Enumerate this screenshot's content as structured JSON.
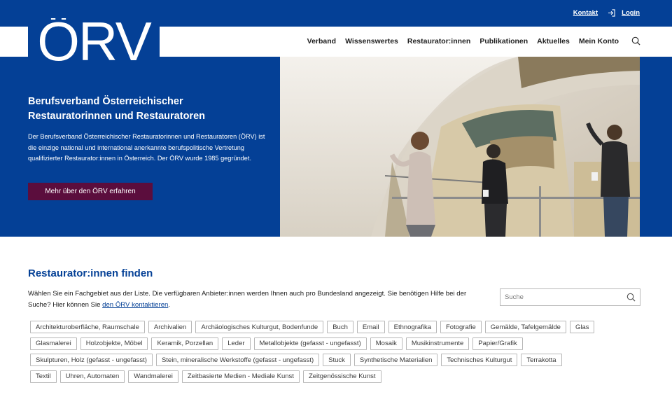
{
  "header": {
    "contact_label": "Kontakt",
    "login_label": "Login",
    "logo_text": "ÖRV"
  },
  "nav": {
    "items": [
      "Verband",
      "Wissenswertes",
      "Restaurator:innen",
      "Publikationen",
      "Aktuelles",
      "Mein Konto"
    ]
  },
  "hero": {
    "title": "Berufsverband Österreichischer Restauratorinnen und Restauratoren",
    "text": "Der Berufsverband Österreichischer Restauratorinnen und Restauratoren (ÖRV) ist die einzige national und international anerkannte berufspolitische Vertretung qualifizierter Restaurator:innen in Österreich. Der ÖRV wurde 1985 gegründet.",
    "button_label": "Mehr über den ÖRV erfahren"
  },
  "finder": {
    "title": "Restaurator:innen finden",
    "intro_text": "Wählen Sie ein Fachgebiet aus der Liste. Die verfügbaren Anbieter:innen werden Ihnen auch pro Bundesland angezeigt. Sie benötigen Hilfe bei der Suche? Hier können Sie ",
    "contact_link": "den ÖRV kontaktieren",
    "intro_end": ".",
    "search_placeholder": "Suche",
    "tag_rows": [
      [
        "Architekturoberfläche, Raumschale",
        "Archivalien",
        "Archäologisches Kulturgut, Bodenfunde",
        "Buch",
        "Email",
        "Ethnografika",
        "Fotografie",
        "Gemälde, Tafelgemälde",
        "Glas"
      ],
      [
        "Glasmalerei",
        "Holzobjekte, Möbel",
        "Keramik, Porzellan",
        "Leder",
        "Metallobjekte (gefasst - ungefasst)",
        "Mosaik",
        "Musikinstrumente",
        "Papier/Grafik"
      ],
      [
        "Skulpturen, Holz (gefasst - ungefasst)",
        "Stein, mineralische Werkstoffe (gefasst - ungefasst)",
        "Stuck",
        "Synthetische Materialien",
        "Technisches Kulturgut",
        "Terrakotta"
      ],
      [
        "Textil",
        "Uhren, Automaten",
        "Wandmalerei",
        "Zeitbasierte Medien - Mediale Kunst",
        "Zeitgenössische Kunst"
      ]
    ]
  },
  "colors": {
    "brand_blue": "#044096",
    "button_plum": "#5b0d3d"
  },
  "icons": [
    "login-icon",
    "search-icon"
  ]
}
